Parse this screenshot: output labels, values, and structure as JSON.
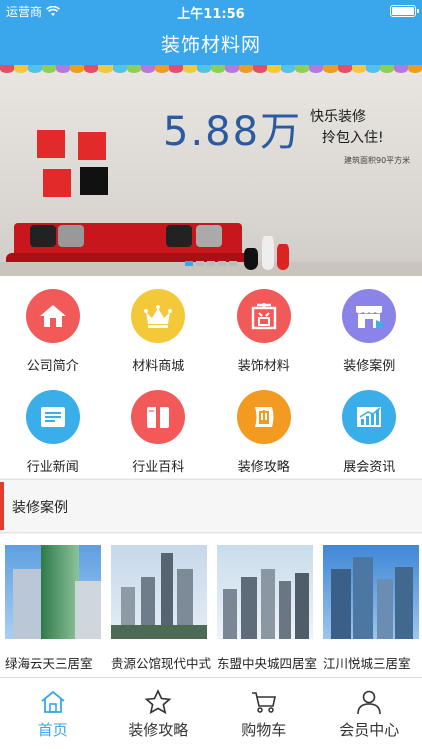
{
  "status_bar": {
    "carrier": "运营商",
    "time": "上午11:56",
    "battery_level": 1.0
  },
  "nav": {
    "title": "装饰材料网"
  },
  "banner": {
    "price": "5.88万",
    "tagline_line1": "快乐装修",
    "tagline_line2": "拎包入住!",
    "area_note": "建筑面积90平方米",
    "pages": 5,
    "active_page": 0
  },
  "grid": {
    "items": [
      {
        "label": "公司简介",
        "icon": "home-icon",
        "color": "#f25a5a"
      },
      {
        "label": "材料商城",
        "icon": "crown-icon",
        "color": "#f3c93a"
      },
      {
        "label": "装饰材料",
        "icon": "shang-icon",
        "color": "#f25a5a"
      },
      {
        "label": "装修案例",
        "icon": "store-icon",
        "color": "#8b84e8"
      },
      {
        "label": "行业新闻",
        "icon": "news-icon",
        "color": "#3aaee8"
      },
      {
        "label": "行业百科",
        "icon": "book-icon",
        "color": "#f25a5a"
      },
      {
        "label": "装修攻略",
        "icon": "dian-icon",
        "color": "#f39a20"
      },
      {
        "label": "展会资讯",
        "icon": "chart-icon",
        "color": "#3aaee8"
      }
    ]
  },
  "section": {
    "title": "装修案例",
    "accent": "#e53a2f"
  },
  "cases": {
    "items": [
      {
        "name": "绿海云天三居室"
      },
      {
        "name": "贵源公馆现代中式"
      },
      {
        "name": "东盟中央城四居室"
      },
      {
        "name": "江川悦城三居室"
      }
    ]
  },
  "tabbar": {
    "active_color": "#3aa6ec",
    "items": [
      {
        "label": "首页",
        "icon": "home-outline-icon"
      },
      {
        "label": "装修攻略",
        "icon": "star-icon"
      },
      {
        "label": "购物车",
        "icon": "cart-icon"
      },
      {
        "label": "会员中心",
        "icon": "user-icon"
      }
    ]
  }
}
